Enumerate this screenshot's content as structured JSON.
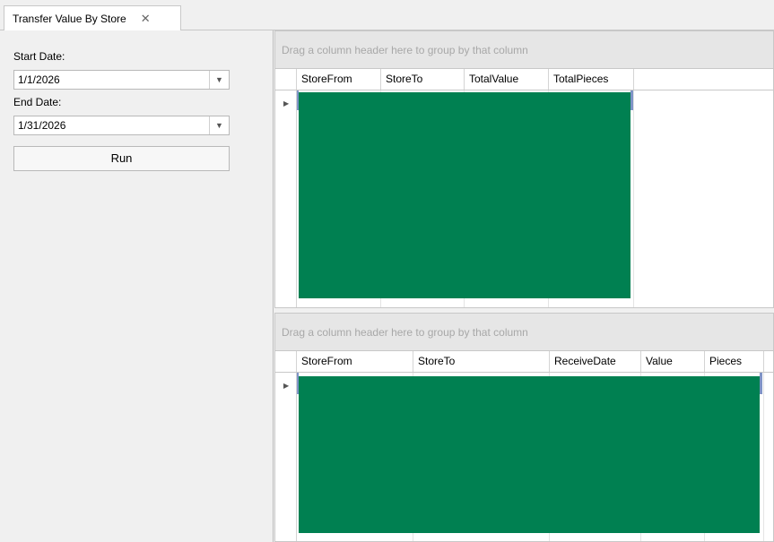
{
  "tab": {
    "title": "Transfer Value By Store",
    "close_glyph": "✕"
  },
  "filters": {
    "start_label": "Start Date:",
    "start_value": "1/1/2026",
    "end_label": "End Date:",
    "end_value": "1/31/2026",
    "dropdown_glyph": "▼",
    "run_label": "Run"
  },
  "grid_top": {
    "group_hint": "Drag a column header here to group by that column",
    "columns": [
      "StoreFrom",
      "StoreTo",
      "TotalValue",
      "TotalPieces"
    ],
    "row_indicator": "▶"
  },
  "grid_bottom": {
    "group_hint": "Drag a column header here to group by that column",
    "columns": [
      "StoreFrom",
      "StoreTo",
      "ReceiveDate",
      "Value",
      "Pieces"
    ],
    "row_indicator": "▶"
  },
  "colors": {
    "redaction": "#008051",
    "focus": "#7f94c6"
  }
}
